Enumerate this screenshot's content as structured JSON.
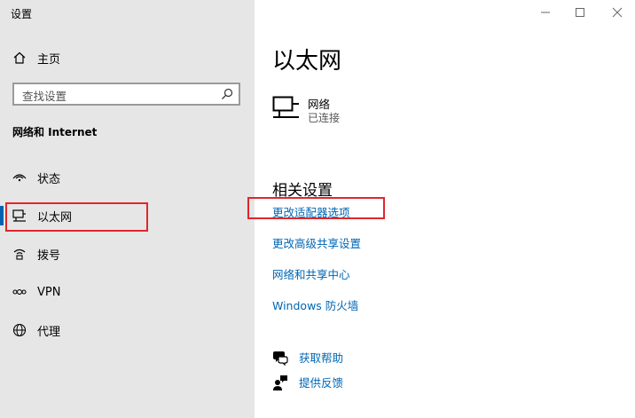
{
  "window": {
    "title": "设置"
  },
  "sidebar": {
    "home_label": "主页",
    "search_placeholder": "查找设置",
    "section_heading": "网络和 Internet",
    "items": [
      {
        "label": "状态",
        "icon": "status-icon"
      },
      {
        "label": "以太网",
        "icon": "ethernet-icon",
        "selected": true
      },
      {
        "label": "拨号",
        "icon": "dialup-icon"
      },
      {
        "label": "VPN",
        "icon": "vpn-icon"
      },
      {
        "label": "代理",
        "icon": "globe-icon"
      }
    ]
  },
  "main": {
    "page_title": "以太网",
    "network": {
      "name": "网络",
      "status": "已连接"
    },
    "related_heading": "相关设置",
    "links": [
      {
        "label": "更改适配器选项"
      },
      {
        "label": "更改高级共享设置"
      },
      {
        "label": "网络和共享中心"
      },
      {
        "label": "Windows 防火墙"
      }
    ],
    "help": [
      {
        "label": "获取帮助",
        "icon": "help-chat-icon"
      },
      {
        "label": "提供反馈",
        "icon": "feedback-icon"
      }
    ]
  },
  "colors": {
    "accent": "#0063b1",
    "link": "#0066b4",
    "highlight": "#e0262b",
    "sidebar_bg": "#e6e6e6"
  }
}
